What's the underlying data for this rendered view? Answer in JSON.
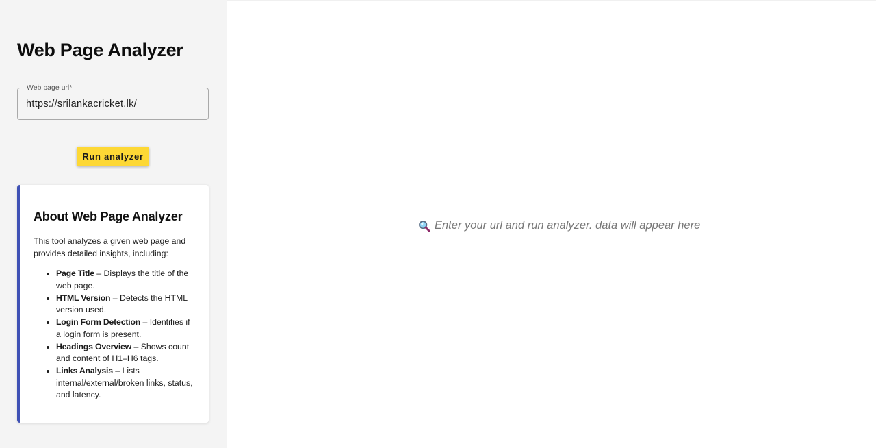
{
  "sidebar": {
    "title": "Web Page Analyzer",
    "url_field": {
      "label": "Web page url*",
      "value": "https://srilankacricket.lk/"
    },
    "run_button_label": "Run analyzer",
    "about": {
      "title": "About Web Page Analyzer",
      "intro": "This tool analyzes a given web page and provides detailed insights, including:",
      "features": [
        {
          "name": "Page Title",
          "desc": " – Displays the title of the web page."
        },
        {
          "name": "HTML Version",
          "desc": " – Detects the HTML version used."
        },
        {
          "name": "Login Form Detection",
          "desc": " – Identifies if a login form is present."
        },
        {
          "name": "Headings Overview",
          "desc": " – Shows count and content of H1–H6 tags."
        },
        {
          "name": "Links Analysis",
          "desc": " – Lists internal/external/broken links, status, and latency."
        }
      ]
    }
  },
  "main": {
    "placeholder_icon": "magnifier-icon",
    "placeholder_text": "Enter your url and run analyzer. data will appear here"
  },
  "colors": {
    "accent_button": "#fdd835",
    "card_border": "#3f51b5",
    "sidebar_bg": "#f4f4f4"
  }
}
